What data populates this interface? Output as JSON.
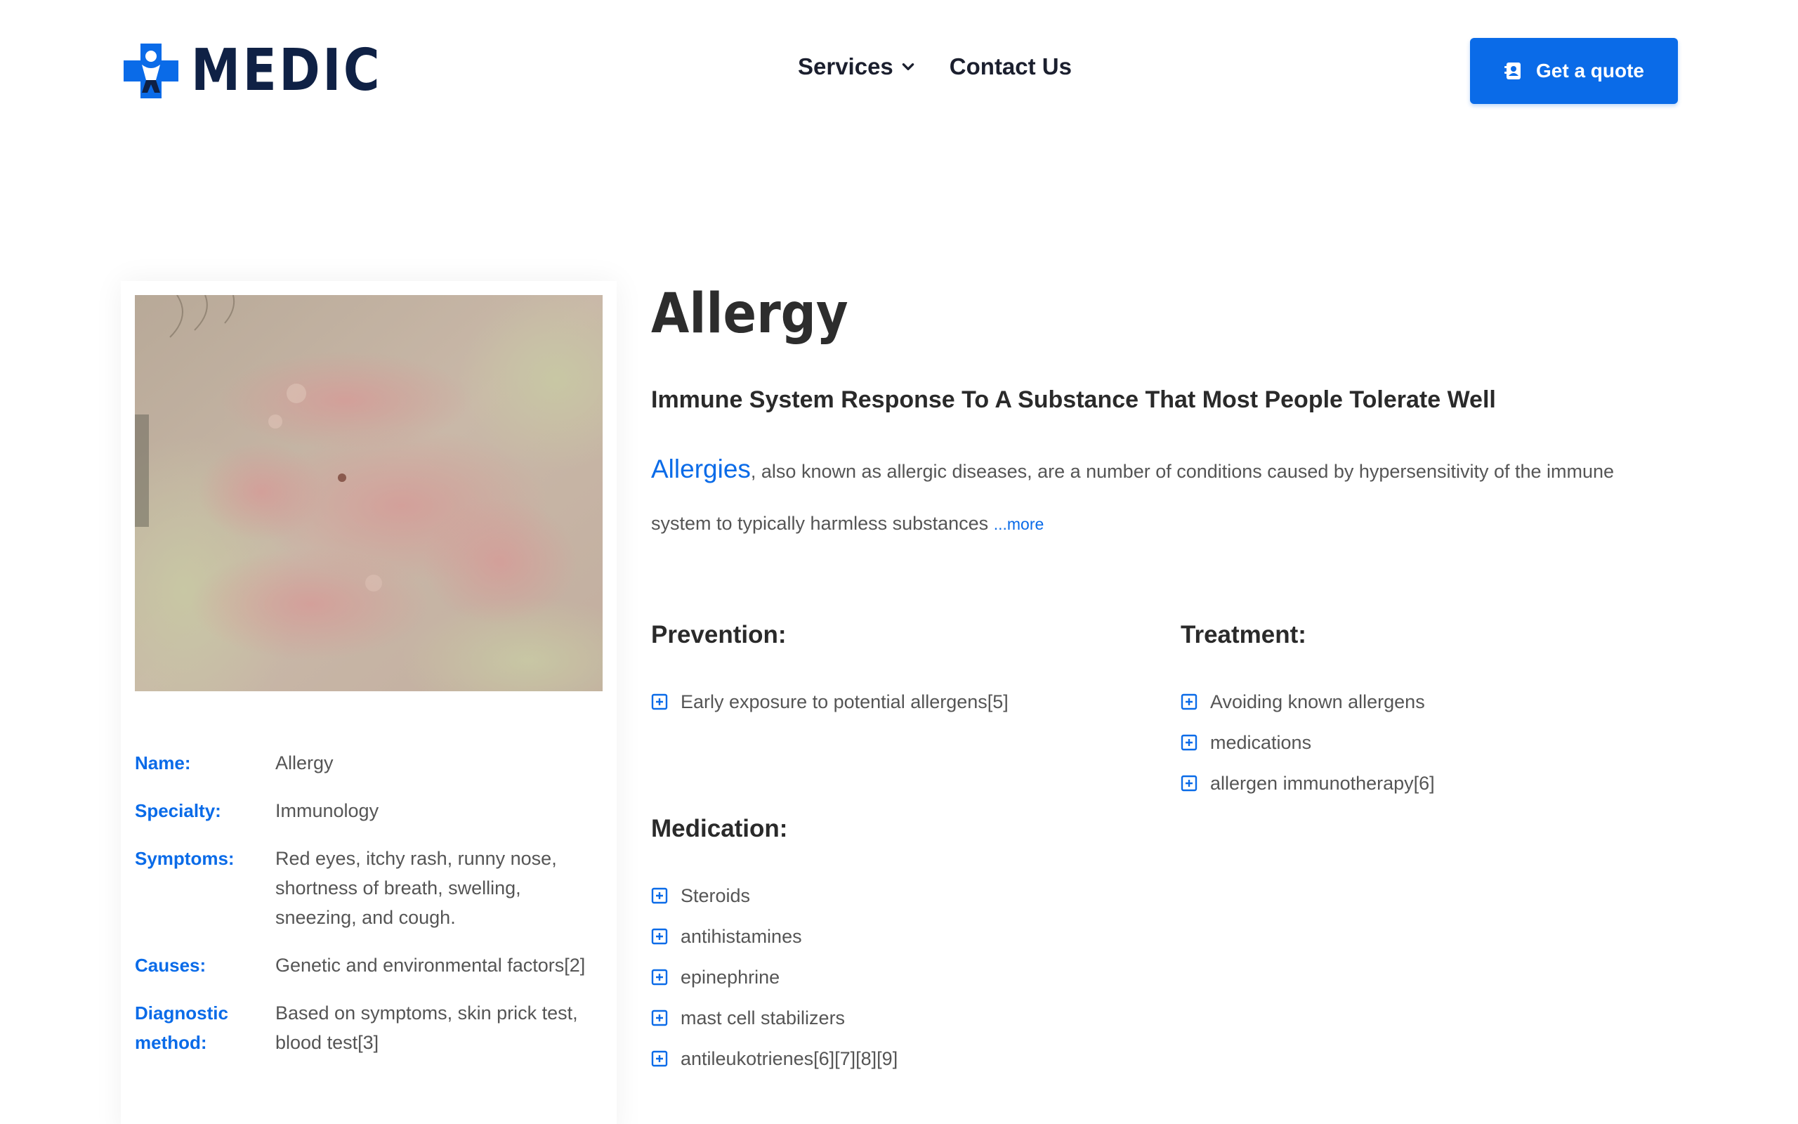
{
  "brand": {
    "name": "MEDIC",
    "accent": "#0a6be8",
    "dark": "#0f2145"
  },
  "nav": {
    "items": [
      {
        "label": "Services",
        "has_dropdown": true
      },
      {
        "label": "Contact Us",
        "has_dropdown": false
      }
    ],
    "cta": {
      "label": "Get a quote",
      "icon": "contact-book-icon"
    }
  },
  "profile": {
    "image_alt": "Allergy skin rash",
    "fields": [
      {
        "label": "Name:",
        "value": "Allergy"
      },
      {
        "label": "Specialty:",
        "value": "Immunology"
      },
      {
        "label": "Symptoms:",
        "value": "Red eyes, itchy rash, runny nose, shortness of breath, swelling, sneezing, and cough."
      },
      {
        "label": "Causes:",
        "value": "Genetic and environmental factors[2]"
      },
      {
        "label": "Diagnostic method:",
        "value": "Based on symptoms, skin prick test, blood test[3]"
      }
    ]
  },
  "article": {
    "title": "Allergy",
    "subtitle": "Immune System Response To A Substance That Most People Tolerate Well",
    "lead_link": "Allergies",
    "description": ", also known as allergic diseases, are a number of conditions caused by hypersensitivity of the immune system to typically harmless substances",
    "more_link": "...more"
  },
  "prevention": {
    "title": "Prevention:",
    "items": [
      "Early exposure to potential allergens[5]"
    ]
  },
  "treatment": {
    "title": "Treatment:",
    "items": [
      "Avoiding known allergens",
      "medications",
      "allergen immunotherapy[6]"
    ]
  },
  "medication": {
    "title": "Medication:",
    "items": [
      "Steroids",
      "antihistamines",
      "epinephrine",
      "mast cell stabilizers",
      "antileukotrienes[6][7][8][9]"
    ]
  }
}
